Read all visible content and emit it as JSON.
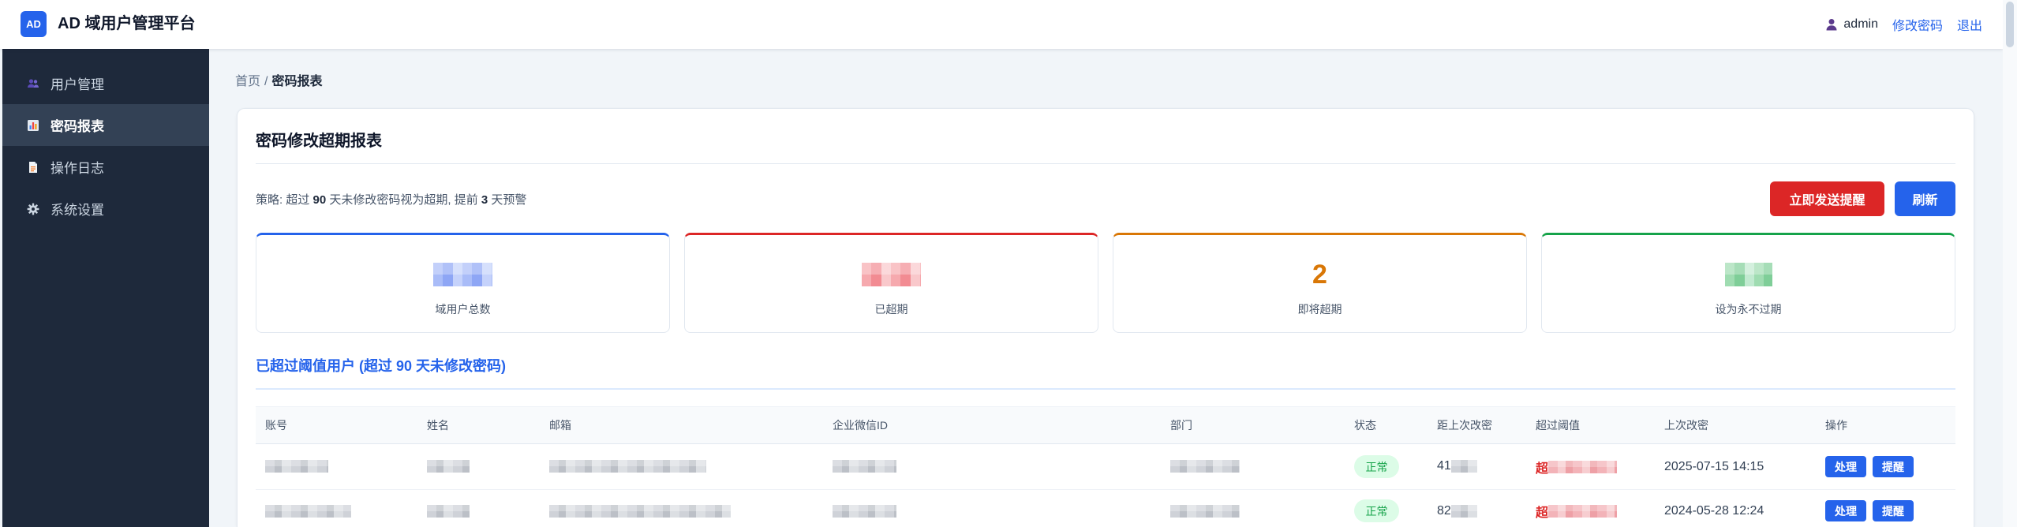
{
  "app": {
    "logo_text": "AD",
    "title": "AD 域用户管理平台"
  },
  "header": {
    "user_icon": "user-icon",
    "username": "admin",
    "change_password": "修改密码",
    "logout": "退出"
  },
  "sidebar": {
    "items": [
      {
        "label": "用户管理",
        "icon": "users-icon",
        "active": false
      },
      {
        "label": "密码报表",
        "icon": "chart-icon",
        "active": true
      },
      {
        "label": "操作日志",
        "icon": "document-icon",
        "active": false
      },
      {
        "label": "系统设置",
        "icon": "gear-icon",
        "active": false
      }
    ]
  },
  "breadcrumb": {
    "home": "首页",
    "separator": "/",
    "current": "密码报表"
  },
  "report": {
    "title": "密码修改超期报表",
    "policy": {
      "prefix": "策略: 超过 ",
      "expire_days": "90",
      "middle": " 天未修改密码视为超期, 提前 ",
      "warn_days": "3",
      "suffix": " 天预警"
    },
    "actions": {
      "send_reminder": "立即发送提醒",
      "refresh": "刷新"
    },
    "stats": [
      {
        "label": "域用户总数",
        "color": "#2563eb"
      },
      {
        "label": "已超期",
        "color": "#dc2626"
      },
      {
        "label": "即将超期",
        "value": "2",
        "color": "#d97706"
      },
      {
        "label": "设为永不过期",
        "color": "#16a34a"
      }
    ],
    "section_title": "已超过阈值用户 (超过 90 天未修改密码)",
    "table": {
      "columns": [
        "账号",
        "姓名",
        "邮箱",
        "企业微信ID",
        "部门",
        "状态",
        "距上次改密",
        "超过阈值",
        "上次改密",
        "操作"
      ],
      "rows": [
        {
          "status": "正常",
          "days_since_change": "41",
          "over_threshold": "超",
          "last_changed": "2025-07-15 14:15",
          "actions": [
            "处理",
            "提醒"
          ]
        },
        {
          "status": "正常",
          "days_since_change": "82",
          "over_threshold": "超",
          "last_changed": "2024-05-28 12:24",
          "actions": [
            "处理",
            "提醒"
          ]
        }
      ]
    }
  },
  "colors": {
    "brand": "#2563eb",
    "danger": "#dc2626",
    "warning": "#d97706",
    "success": "#16a34a",
    "sidebar_bg": "#1e293b",
    "sidebar_active_bg": "#334155",
    "page_bg": "#f1f5f9"
  }
}
